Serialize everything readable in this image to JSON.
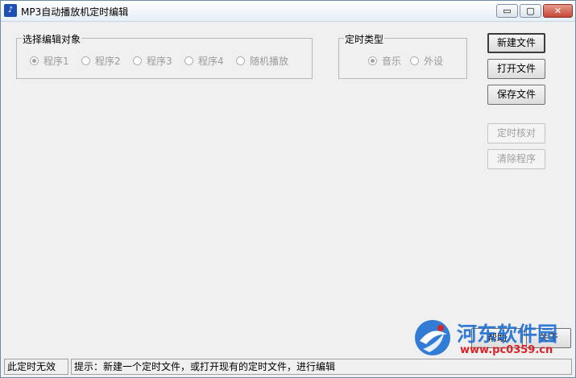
{
  "window": {
    "title": "MP3自动播放机定时编辑",
    "controls": {
      "minimize": "▭",
      "maximize": "▢",
      "close": "✕"
    }
  },
  "edit_target_group": {
    "label": "选择编辑对象",
    "options": [
      "程序1",
      "程序2",
      "程序3",
      "程序4",
      "随机播放"
    ],
    "selected": "程序1"
  },
  "timer_type_group": {
    "label": "定时类型",
    "options": [
      "音乐",
      "外设"
    ],
    "selected": "音乐"
  },
  "buttons": {
    "new_file": "新建文件",
    "open_file": "打开文件",
    "save_file": "保存文件",
    "timer_check": "定时核对",
    "clear_program": "清除程序",
    "help": "帮助",
    "about": "关于"
  },
  "statusbar": {
    "left": "此定时无效",
    "hint": "提示：新建一个定时文件，或打开现有的定时文件，进行编辑"
  },
  "watermark": {
    "title": "河东软件园",
    "url": "www.pc0359.cn"
  },
  "colors": {
    "window_bg": "#f0f0f0",
    "close_button": "#c34a36",
    "watermark_blue": "#1e6fd2",
    "watermark_red": "#d8242a"
  }
}
